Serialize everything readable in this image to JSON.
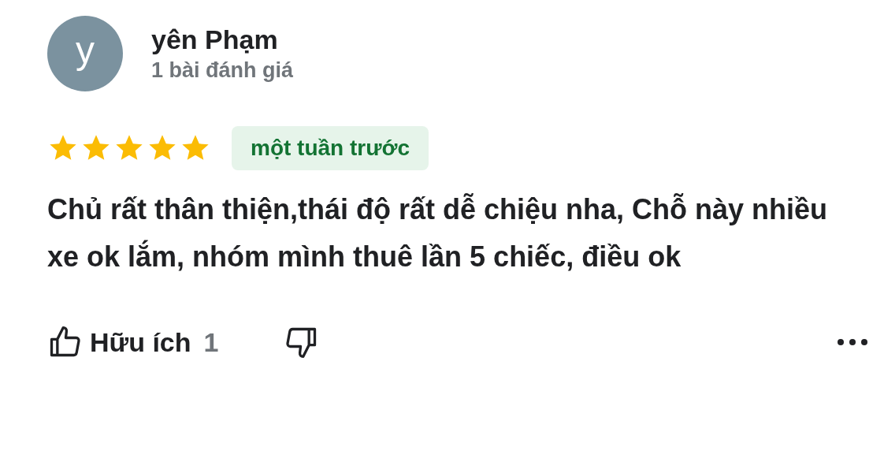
{
  "reviewer": {
    "initial": "y",
    "name": "yên Phạm",
    "review_count": "1 bài đánh giá"
  },
  "stars": 5,
  "time_badge": "một tuần trước",
  "text": "Chủ rất thân thiện,thái độ rất dễ chiệu nha, Chỗ này nhiều xe ok lắm, nhóm mình thuê lần 5 chiếc, điều ok",
  "helpful": {
    "label": "Hữu ích",
    "count": "1"
  }
}
